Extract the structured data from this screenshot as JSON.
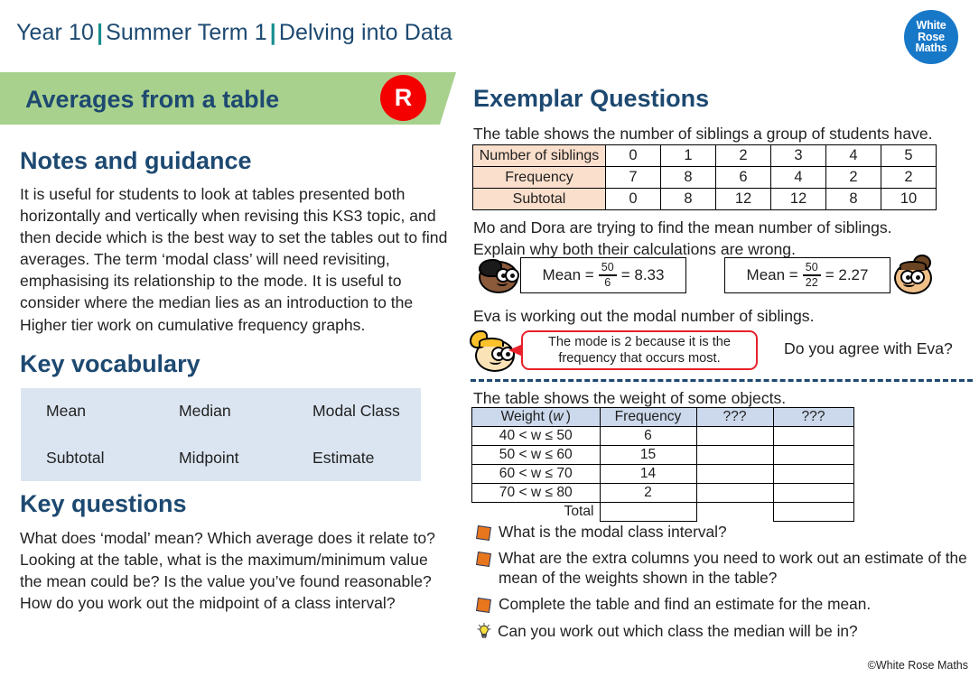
{
  "header": {
    "year": "Year 10",
    "term": "Summer Term  1",
    "unit": "Delving into Data",
    "logo_line1": "White",
    "logo_line2": "Rose",
    "logo_line3": "Maths"
  },
  "banner": {
    "title": "Averages from a table",
    "badge": "R",
    "badge_color": "#f50000",
    "band_color": "#a9d18e"
  },
  "left": {
    "notes_heading": "Notes and guidance",
    "notes_body": "It is useful for students to look at tables presented both horizontally and vertically when revising this KS3 topic, and then decide which is the best way to set the tables out to find averages. The term ‘modal class’ will need revisiting, emphasising its relationship to the mode. It is useful to consider where the median lies as an introduction to the Higher tier work on cumulative frequency graphs.",
    "vocab_heading": "Key vocabulary",
    "vocab_items": [
      "Mean",
      "Median",
      "Modal Class",
      "Subtotal",
      "Midpoint",
      "Estimate"
    ],
    "questions_heading": "Key questions",
    "questions_body": "What does ‘modal’ mean? Which average does it relate to? Looking at the table, what is the maximum/minimum value the mean could be? Is the value you’ve found reasonable?\nHow do you work out the midpoint of a class interval?"
  },
  "right": {
    "heading": "Exemplar Questions",
    "siblings_caption": "The table shows the number of siblings a group of students have.",
    "siblings_table": {
      "row_labels": [
        "Number of siblings",
        "Frequency",
        "Subtotal"
      ],
      "rows": [
        [
          "0",
          "1",
          "2",
          "3",
          "4",
          "5"
        ],
        [
          "7",
          "8",
          "6",
          "4",
          "2",
          "2"
        ],
        [
          "0",
          "8",
          "12",
          "12",
          "8",
          "10"
        ]
      ]
    },
    "mo_dora_caption": "Mo and Dora are trying to find the mean number of siblings.\nExplain why both their calculations are wrong.",
    "mo_calc": {
      "label": "Mean =",
      "numerator": "50",
      "denominator": "6",
      "equals": "= 8.33"
    },
    "dora_calc": {
      "label": "Mean =",
      "numerator": "50",
      "denominator": "22",
      "equals": "= 2.27"
    },
    "eva_caption": "Eva is working out the modal number of siblings.",
    "eva_bubble": "The mode is 2 because it is the frequency that occurs most.",
    "eva_question": "Do you agree with Eva?",
    "weight_caption": "The table shows the weight of some objects.",
    "weight_table": {
      "headers": [
        "Weight (w)",
        "Frequency",
        "???",
        "???"
      ],
      "rows": [
        [
          "40 < w ≤ 50",
          "6",
          "",
          ""
        ],
        [
          "50 < w ≤ 60",
          "15",
          "",
          ""
        ],
        [
          "60 < w ≤ 70",
          "14",
          "",
          ""
        ],
        [
          "70 < w ≤ 80",
          "2",
          "",
          ""
        ]
      ],
      "total_label": "Total"
    },
    "bullets": [
      {
        "icon": "orange-diamond-bullet",
        "text": "What is the modal class interval?"
      },
      {
        "icon": "orange-diamond-bullet",
        "text": "What are the extra columns you need to work out an estimate of the mean of the weights shown in the table?"
      },
      {
        "icon": "orange-diamond-bullet",
        "text": "Complete the table and find an estimate for the mean."
      },
      {
        "icon": "lightbulb-bullet",
        "text": "Can you work out which class the median will be in?"
      }
    ]
  },
  "footer": "©White Rose Maths"
}
